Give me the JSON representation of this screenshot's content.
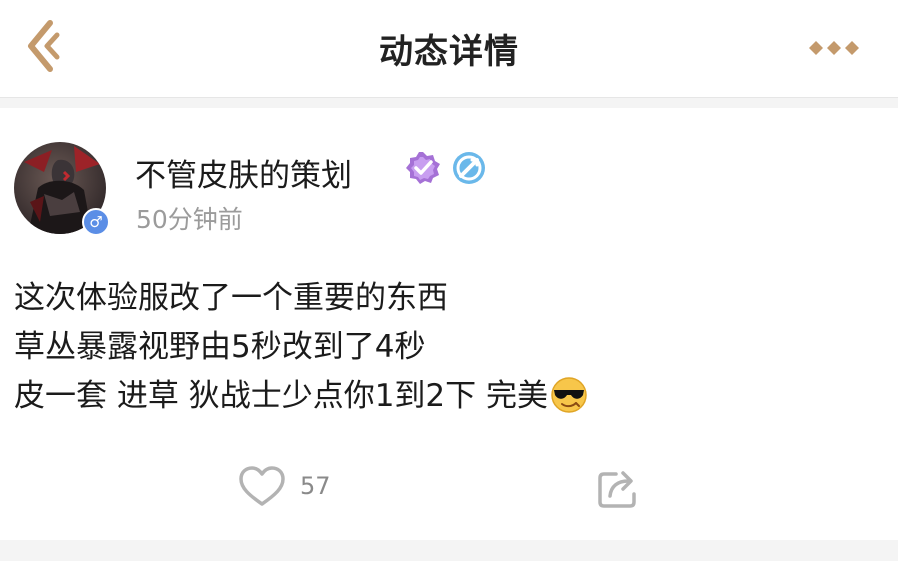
{
  "header": {
    "title": "动态详情",
    "back_icon": "chevron-left-icon",
    "more_icon": "more-dots-icon",
    "accent_color": "#c49a6c"
  },
  "post": {
    "author": {
      "name": "不管皮肤的策划",
      "gender_symbol": "♂",
      "avatar_icon": "avatar-warrior-image",
      "badges": [
        "verified-badge-icon",
        "level-badge-icon"
      ]
    },
    "time": "50分钟前",
    "lines": [
      "这次体验服改了一个重要的东西",
      "草丛暴露视野由5秒改到了4秒",
      "皮一套 进草 狄战士少点你1到2下 完美"
    ],
    "trailing_emoji": "cool-sunglasses-emoji",
    "actions": {
      "like_count": "57",
      "like_icon": "heart-icon",
      "share_icon": "share-icon"
    }
  }
}
